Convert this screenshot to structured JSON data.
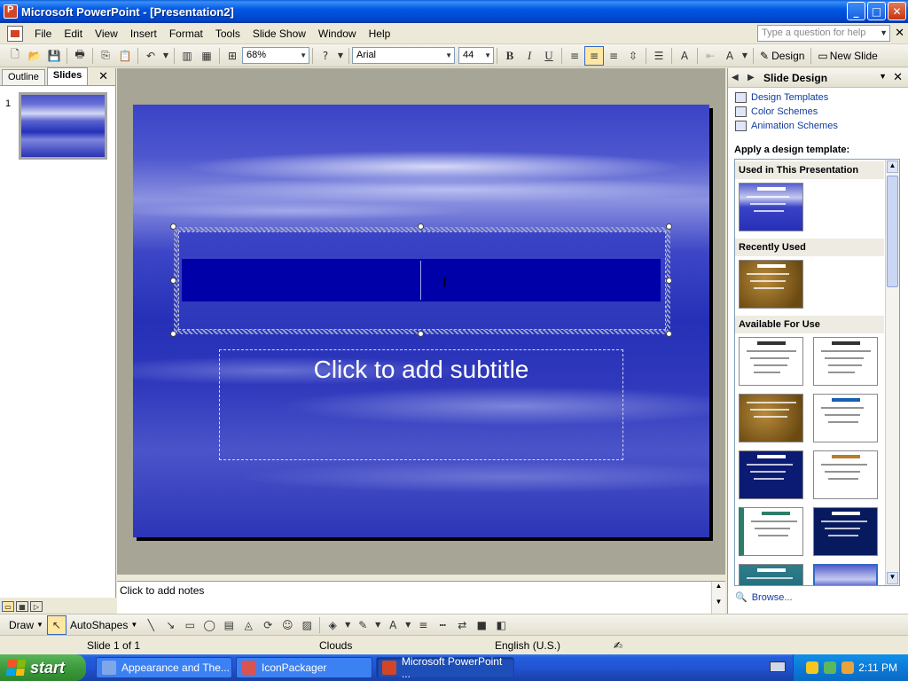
{
  "window": {
    "title": "Microsoft PowerPoint - [Presentation2]",
    "min": "_",
    "max": "□",
    "close": "✕"
  },
  "menu": {
    "items": [
      "File",
      "Edit",
      "View",
      "Insert",
      "Format",
      "Tools",
      "Slide Show",
      "Window",
      "Help"
    ],
    "help_placeholder": "Type a question for help",
    "close": "✕"
  },
  "toolbar": {
    "zoom": "68%",
    "font": "Arial",
    "size": "44",
    "bold": "B",
    "italic": "I",
    "underline": "U",
    "design": "Design",
    "new_slide": "New Slide"
  },
  "left_panel": {
    "tabs": [
      "Outline",
      "Slides"
    ],
    "selected_tab": "Slides",
    "close": "✕",
    "slide_number": "1"
  },
  "slide": {
    "subtitle_placeholder": "Click to add subtitle"
  },
  "notes": {
    "placeholder": "Click to add notes"
  },
  "task_pane": {
    "title": "Slide Design",
    "links": [
      "Design Templates",
      "Color Schemes",
      "Animation Schemes"
    ],
    "apply_label": "Apply a design template:",
    "sections": [
      "Used in This Presentation",
      "Recently Used",
      "Available For Use"
    ],
    "browse": "Browse..."
  },
  "draw_toolbar": {
    "draw": "Draw",
    "autoshapes": "AutoShapes"
  },
  "status": {
    "slide": "Slide 1 of 1",
    "design": "Clouds",
    "language": "English (U.S.)"
  },
  "taskbar": {
    "start": "start",
    "tasks": [
      "Appearance and The...",
      "IconPackager",
      "Microsoft PowerPoint ..."
    ],
    "clock": "2:11 PM"
  },
  "colors": {
    "titlebar": "#0058E6",
    "slide_bg": "#2530B8",
    "selection": "#0000A8",
    "link": "#0F3C9E"
  }
}
